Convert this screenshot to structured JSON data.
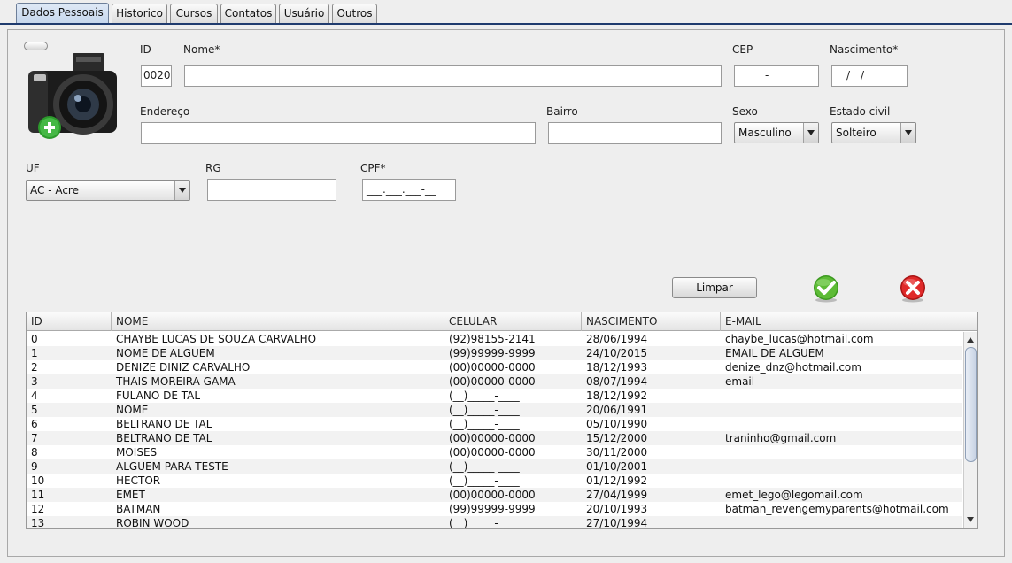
{
  "tabs": [
    {
      "label": "Dados Pessoais",
      "active": true
    },
    {
      "label": "Historico",
      "active": false
    },
    {
      "label": "Cursos",
      "active": false
    },
    {
      "label": "Contatos",
      "active": false
    },
    {
      "label": "Usuário",
      "active": false
    },
    {
      "label": "Outros",
      "active": false
    }
  ],
  "photo": {
    "icon": "camera-add-icon"
  },
  "form": {
    "id_label": "ID",
    "id_value": "0020",
    "nome_label": "Nome*",
    "nome_value": "",
    "cep_label": "CEP",
    "cep_value": "_____-___",
    "nascimento_label": "Nascimento*",
    "nascimento_value": "__/__/____",
    "endereco_label": "Endereço",
    "endereco_value": "",
    "bairro_label": "Bairro",
    "bairro_value": "",
    "sexo_label": "Sexo",
    "sexo_value": "Masculino",
    "estado_civil_label": "Estado civil",
    "estado_civil_value": "Solteiro",
    "uf_label": "UF",
    "uf_value": "AC - Acre",
    "rg_label": "RG",
    "rg_value": "",
    "cpf_label": "CPF*",
    "cpf_value": "___.___.___-__"
  },
  "actions": {
    "limpar_label": "Limpar",
    "confirm_icon": "green-check-icon",
    "cancel_icon": "red-x-icon",
    "colors": {
      "confirm": "#4caf2a",
      "cancel": "#d62020"
    }
  },
  "table": {
    "columns": [
      "ID",
      "NOME",
      "CELULAR",
      "NASCIMENTO",
      "E-MAIL"
    ],
    "rows": [
      [
        "0",
        "CHAYBE LUCAS DE SOUZA CARVALHO",
        "(92)98155-2141",
        "28/06/1994",
        "chaybe_lucas@hotmail.com"
      ],
      [
        "1",
        "NOME DE ALGUEM",
        "(99)99999-9999",
        "24/10/2015",
        "EMAIL DE ALGUEM"
      ],
      [
        "2",
        "DENIZE DINIZ CARVALHO",
        "(00)00000-0000",
        "18/12/1993",
        "denize_dnz@hotmail.com"
      ],
      [
        "3",
        "THAIS MOREIRA GAMA",
        "(00)00000-0000",
        "08/07/1994",
        "email"
      ],
      [
        "4",
        "FULANO DE TAL",
        "(__)_____-____",
        "18/12/1992",
        ""
      ],
      [
        "5",
        "NOME",
        "(__)_____-____",
        "20/06/1991",
        ""
      ],
      [
        "6",
        "BELTRANO DE TAL",
        "(__)_____-____",
        "05/10/1990",
        ""
      ],
      [
        "7",
        "BELTRANO DE TAL",
        "(00)00000-0000",
        "15/12/2000",
        "traninho@gmail.com"
      ],
      [
        "8",
        "MOISES",
        "(00)00000-0000",
        "30/11/2000",
        ""
      ],
      [
        "9",
        "ALGUEM PARA TESTE",
        "(__)_____-____",
        "01/10/2001",
        ""
      ],
      [
        "10",
        "HECTOR",
        "(__)_____-____",
        "01/12/1992",
        ""
      ],
      [
        "11",
        "EMET",
        "(00)00000-0000",
        "27/04/1999",
        "emet_lego@legomail.com"
      ],
      [
        "12",
        "BATMAN",
        "(99)99999-9999",
        "20/10/1993",
        "batman_revengemyparents@hotmail.com"
      ],
      [
        "13",
        "ROBIN WOOD",
        "(__)_____-____",
        "27/10/1994",
        ""
      ]
    ]
  }
}
